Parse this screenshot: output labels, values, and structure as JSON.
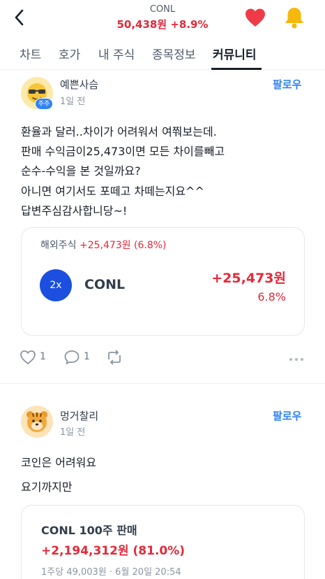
{
  "header": {
    "ticker": "CONL",
    "price_line": "50,438원 +8.9%",
    "colors": {
      "up": "#e42939",
      "heart": "#ef3b49",
      "bell": "#f6b80c"
    }
  },
  "tabs": [
    {
      "label": "차트"
    },
    {
      "label": "호가"
    },
    {
      "label": "내 주식"
    },
    {
      "label": "종목정보"
    },
    {
      "label": "커뮤니티",
      "active": true
    }
  ],
  "posts": [
    {
      "author": "예쁜사슴",
      "badge": "주주",
      "time": "1일 전",
      "follow": "팔로우",
      "lines": [
        "환율과 달러..차이가 어려워서 여쭤보는데.",
        "판매 수익금이25,473이면 모든 차이를빼고",
        "순수-수익을 본 것일까요?",
        "아니면 여기서도 포떼고 차떼는지요^^",
        "답변주심감사합니당~!"
      ],
      "card": {
        "label": "해외주식",
        "label_gain": "+25,473원 (6.8%)",
        "coin_badge": "2x",
        "coin_name": "CONL",
        "gain_amount": "+25,473원",
        "gain_pct": "6.8%"
      },
      "likes": "1",
      "comments": "1"
    },
    {
      "author": "멍거찰리",
      "time": "1일 전",
      "follow": "팔로우",
      "lines": [
        "코인은 어려워요",
        "요기까지만"
      ],
      "card": {
        "title": "CONL 100주 판매",
        "gain": "+2,194,312원 (81.0%)",
        "meta": "1주당 49,003원 · 6월 20일 20:54"
      }
    }
  ]
}
